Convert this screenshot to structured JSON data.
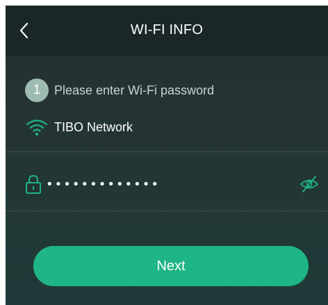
{
  "header": {
    "title": "WI-FI INFO",
    "back_icon": "chevron-left-icon"
  },
  "step": {
    "number": "1",
    "text": "Please enter Wi-Fi password"
  },
  "network": {
    "icon": "wifi-icon",
    "name": "TIBO Network"
  },
  "password": {
    "value": "•••••••••••••",
    "lock_icon": "lock-icon",
    "visibility_icon": "eye-off-icon"
  },
  "next_button": {
    "label": "Next"
  },
  "colors": {
    "accent": "#1fb586",
    "header_bg": "#1b2626",
    "step_badge": "#9ebbb2"
  }
}
